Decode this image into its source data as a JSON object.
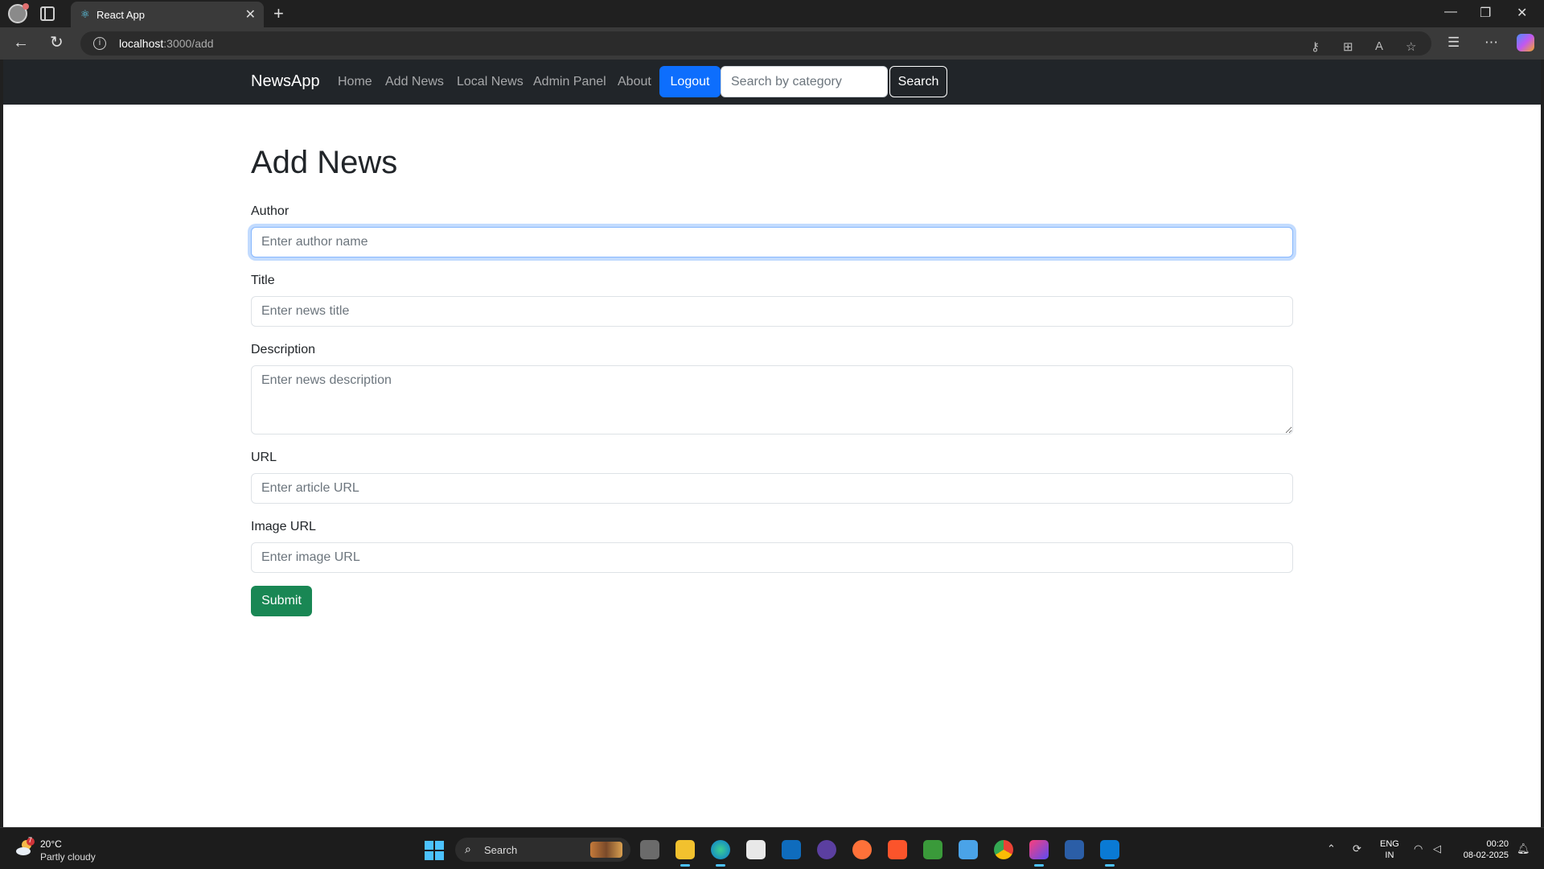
{
  "browser": {
    "tab_title": "React App",
    "url_host": "localhost",
    "url_path": ":3000/add"
  },
  "navbar": {
    "brand": "NewsApp",
    "links": [
      "Home",
      "Add News",
      "Local News",
      "Admin Panel",
      "About"
    ],
    "logout_label": "Logout",
    "search_placeholder": "Search by category",
    "search_label": "Search"
  },
  "form": {
    "heading": "Add News",
    "author_label": "Author",
    "author_placeholder": "Enter author name",
    "title_label": "Title",
    "title_placeholder": "Enter news title",
    "description_label": "Description",
    "description_placeholder": "Enter news description",
    "url_label": "URL",
    "url_placeholder": "Enter article URL",
    "image_label": "Image URL",
    "image_placeholder": "Enter image URL",
    "submit_label": "Submit"
  },
  "taskbar": {
    "temperature": "20°C",
    "weather": "Partly cloudy",
    "weather_badge": "7",
    "search_label": "Search",
    "lang_top": "ENG",
    "lang_bottom": "IN",
    "time": "00:20",
    "date": "08-02-2025"
  },
  "colors": {
    "primary": "#0d6efd",
    "success": "#198754",
    "navbar_bg": "#212529"
  }
}
